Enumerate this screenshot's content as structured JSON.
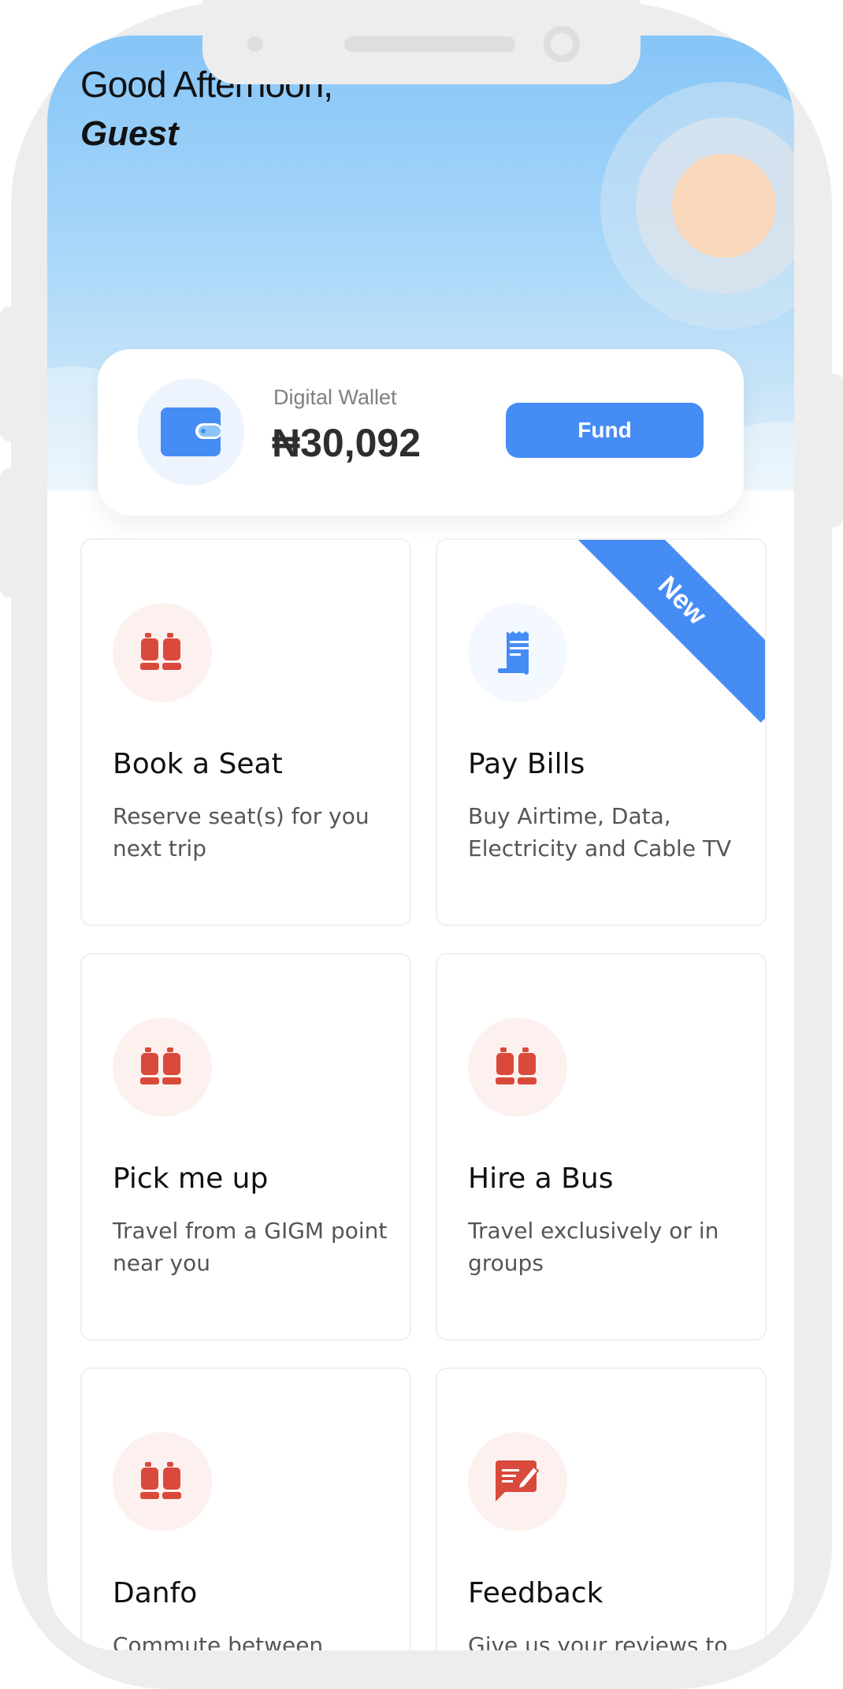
{
  "greeting": {
    "line1": "Good Afternoon,",
    "name": "Guest"
  },
  "wallet": {
    "label": "Digital Wallet",
    "balance": "₦30,092",
    "fund_label": "Fund",
    "icon": "wallet-icon"
  },
  "colors": {
    "accent": "#468cf5",
    "service_red": "#d94a3c"
  },
  "services": [
    {
      "title": "Book a Seat",
      "description": "Reserve seat(s) for you next trip",
      "icon": "seat-icon"
    },
    {
      "title": "Pay Bills",
      "description": "Buy Airtime, Data, Electricity and Cable TV",
      "icon": "receipt-icon",
      "badge": "New"
    },
    {
      "title": "Pick me up",
      "description": "Travel from a GIGM point near you",
      "icon": "seat-icon"
    },
    {
      "title": "Hire a Bus",
      "description": "Travel exclusively or in groups",
      "icon": "seat-icon"
    },
    {
      "title": "Danfo",
      "description": "Commute between",
      "icon": "seat-icon"
    },
    {
      "title": "Feedback",
      "description": "Give us your reviews to",
      "icon": "feedback-icon"
    }
  ]
}
